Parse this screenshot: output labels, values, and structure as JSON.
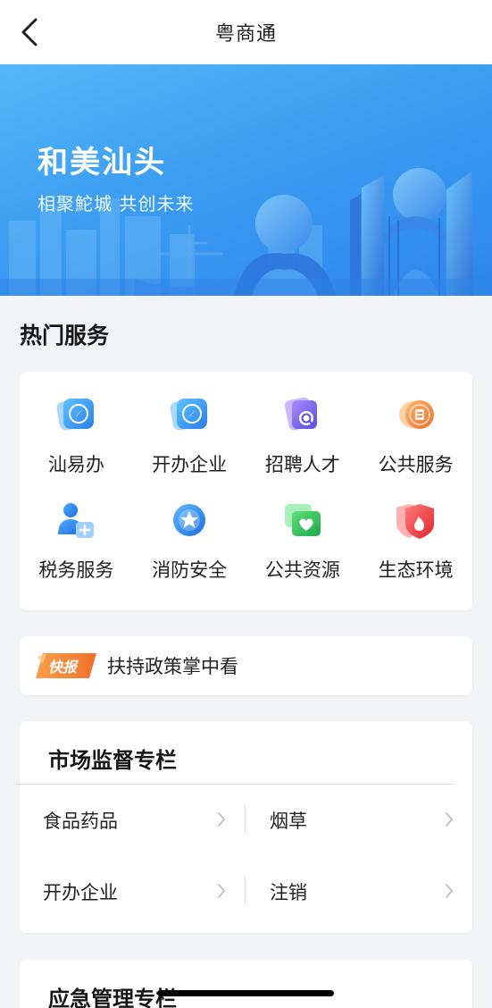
{
  "nav": {
    "title": "粤商通"
  },
  "banner": {
    "title": "和美汕头",
    "subtitle": "相聚鮀城 共创未来"
  },
  "hot_services": {
    "heading": "热门服务",
    "items": [
      {
        "label": "汕易办",
        "icon": "compass-icon"
      },
      {
        "label": "开办企业",
        "icon": "compass-icon"
      },
      {
        "label": "招聘人才",
        "icon": "magnifier-icon"
      },
      {
        "label": "公共服务",
        "icon": "tax-coin-icon"
      },
      {
        "label": "税务服务",
        "icon": "add-user-icon"
      },
      {
        "label": "消防安全",
        "icon": "star-badge-icon"
      },
      {
        "label": "公共资源",
        "icon": "heart-cards-icon"
      },
      {
        "label": "生态环境",
        "icon": "fire-shield-icon"
      }
    ]
  },
  "news": {
    "badge": "快报",
    "text": "扶持政策掌中看"
  },
  "market": {
    "title": "市场监督专栏",
    "links": [
      {
        "label": "食品药品"
      },
      {
        "label": "烟草"
      },
      {
        "label": "开办企业"
      },
      {
        "label": "注销"
      }
    ]
  },
  "emergency": {
    "title": "应急管理专栏"
  },
  "colors": {
    "brand_blue": "#3c9df2",
    "background": "#f3f4f6",
    "card": "#ffffff",
    "badge_orange": "#f07a2c"
  }
}
